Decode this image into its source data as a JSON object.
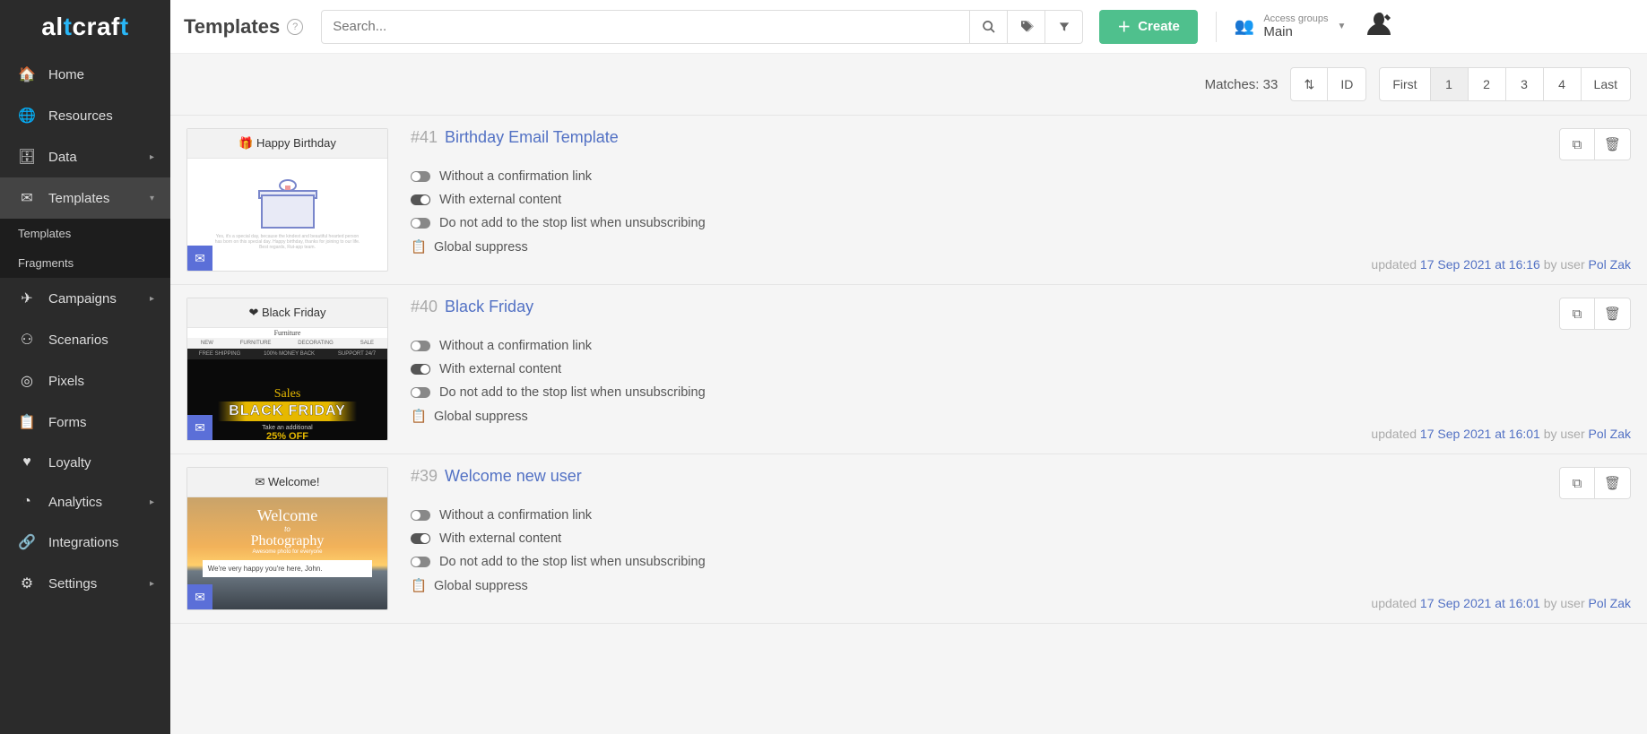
{
  "brand": {
    "part1": "al",
    "accent1": "t",
    "part2": "craf",
    "accent2": "t"
  },
  "sidebar": {
    "items": [
      {
        "label": "Home"
      },
      {
        "label": "Resources"
      },
      {
        "label": "Data"
      },
      {
        "label": "Templates"
      },
      {
        "label": "Campaigns"
      },
      {
        "label": "Scenarios"
      },
      {
        "label": "Pixels"
      },
      {
        "label": "Forms"
      },
      {
        "label": "Loyalty"
      },
      {
        "label": "Analytics"
      },
      {
        "label": "Integrations"
      },
      {
        "label": "Settings"
      }
    ],
    "templates_sub": [
      {
        "label": "Templates"
      },
      {
        "label": "Fragments"
      }
    ]
  },
  "header": {
    "title": "Templates",
    "search_placeholder": "Search...",
    "create_label": "Create",
    "access_label": "Access groups",
    "access_value": "Main"
  },
  "toolbar": {
    "matches_label": "Matches: 33",
    "id_label": "ID",
    "pager": {
      "first": "First",
      "p1": "1",
      "p2": "2",
      "p3": "3",
      "p4": "4",
      "last": "Last"
    }
  },
  "items": [
    {
      "id": "#41",
      "title": "Birthday Email Template",
      "thumb_header": "🎁 Happy Birthday",
      "props": [
        "Without a confirmation link",
        "With external content",
        "Do not add to the stop list when unsubscribing",
        "Global suppress"
      ],
      "updated_prefix": "updated ",
      "updated_date": "17 Sep 2021 at 16:16",
      "by_user_prefix": " by user ",
      "user": "Pol Zak"
    },
    {
      "id": "#40",
      "title": "Black Friday",
      "thumb_header": "❤ Black Friday",
      "props": [
        "Without a confirmation link",
        "With external content",
        "Do not add to the stop list when unsubscribing",
        "Global suppress"
      ],
      "updated_prefix": "updated ",
      "updated_date": "17 Sep 2021 at 16:01",
      "by_user_prefix": " by user ",
      "user": "Pol Zak"
    },
    {
      "id": "#39",
      "title": "Welcome new user",
      "thumb_header": "✉ Welcome!",
      "props": [
        "Without a confirmation link",
        "With external content",
        "Do not add to the stop list when unsubscribing",
        "Global suppress"
      ],
      "updated_prefix": "updated ",
      "updated_date": "17 Sep 2021 at 16:01",
      "by_user_prefix": " by user ",
      "user": "Pol Zak",
      "thumb_text": "We're very happy you're here, John."
    }
  ]
}
